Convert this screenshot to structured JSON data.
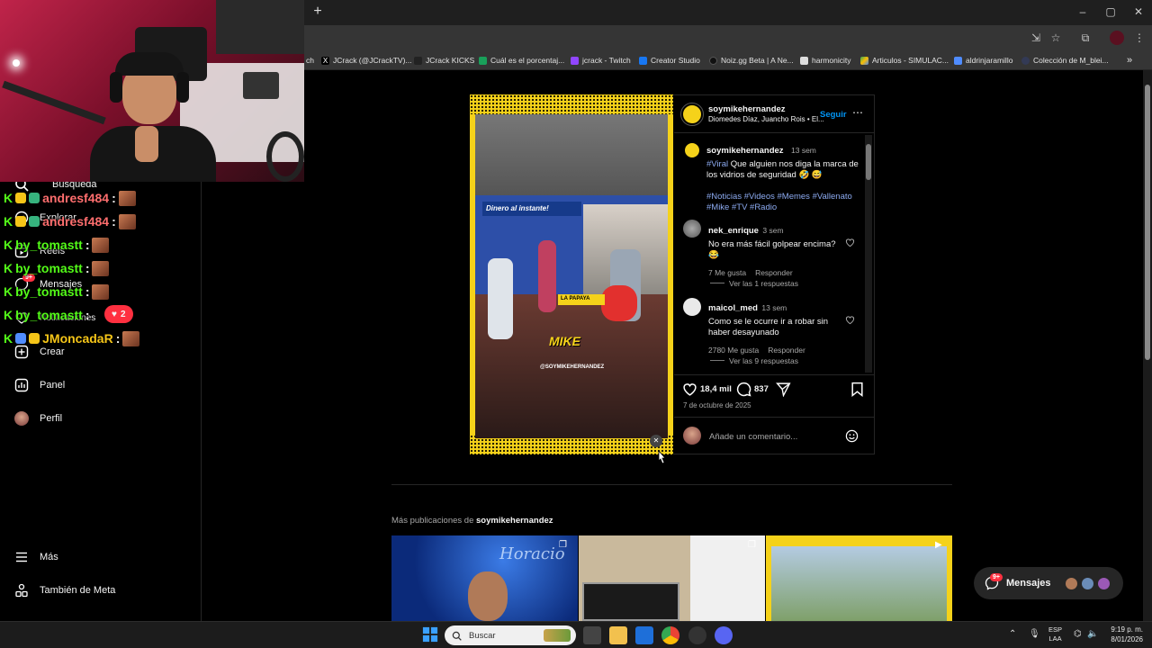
{
  "browser": {
    "new_tab": "+",
    "window_controls": {
      "minimize": "‒",
      "restore": "▢",
      "close": "✕"
    },
    "bookmarks": [
      {
        "label": "ch",
        "color": "#6441a5"
      },
      {
        "label": "JCrack (@JCrackTV)...",
        "color": "#000000"
      },
      {
        "label": "JCrack KICKS",
        "color": "#222222"
      },
      {
        "label": "Cuál es el porcentaj...",
        "color": "#19a05a"
      },
      {
        "label": "jcrack - Twitch",
        "color": "#9146ff"
      },
      {
        "label": "Creator Studio",
        "color": "#1877f2"
      },
      {
        "label": "Noiz.gg Beta | A Ne...",
        "color": "#111111"
      },
      {
        "label": "harmonicity",
        "color": "#dddddd"
      },
      {
        "label": "Articulos - SIMULAC...",
        "color": "#34a853"
      },
      {
        "label": "aldrinjaramillo",
        "color": "#4f8cff"
      },
      {
        "label": "Colección de M_blei...",
        "color": "#333a55"
      }
    ],
    "bookmarks_more": "»"
  },
  "nav": {
    "items": [
      {
        "label": "Búsqueda",
        "icon": "search-icon"
      },
      {
        "label": "Explorar",
        "icon": "compass-icon"
      },
      {
        "label": "Reels",
        "icon": "reels-icon"
      },
      {
        "label": "Mensajes",
        "icon": "messenger-icon",
        "badge": "9+"
      },
      {
        "label": "Notificaciones",
        "icon": "heart-icon"
      },
      {
        "label": "Crear",
        "icon": "plus-icon"
      },
      {
        "label": "Panel",
        "icon": "chart-icon"
      },
      {
        "label": "Perfil",
        "icon": "avatar-icon"
      }
    ],
    "more": "Más",
    "meta": "También de Meta",
    "notification_badge": "2"
  },
  "chat": [
    {
      "user": "andresf484",
      "sep": ":",
      "color": "#ff6e6e"
    },
    {
      "user": "andresf484",
      "sep": ":",
      "color": "#ff6e6e"
    },
    {
      "user": "by_tomastt",
      "sep": ":",
      "color": "#53fc18"
    },
    {
      "user": "by_tomastt",
      "sep": ":",
      "color": "#53fc18"
    },
    {
      "user": "by_tomastt",
      "sep": ":",
      "color": "#53fc18"
    },
    {
      "user": "by_tomastt",
      "sep": ":",
      "color": "#53fc18"
    },
    {
      "user": "JMoncadaR",
      "sep": ":",
      "color": "#f5c518"
    }
  ],
  "post": {
    "author": "soymikehernandez",
    "follow": "Seguir",
    "subtitle": "Diomedes Díaz, Juancho Rois • El...",
    "media_texts": {
      "sign": "Dinero al instante!",
      "stamp": "LA PAPAYA",
      "logo": "MIKE",
      "handle": "@SOYMIKEHERNANDEZ"
    },
    "caption": {
      "user": "soymikehernandez",
      "time": "13 sem",
      "tag_viral": "#Viral",
      "text": " Que alguien nos diga la marca de los vidrios de seguridad 🤣 😅",
      "tags_line1": "#Noticias #Videos #Memes #Vallenato",
      "tags_line2": "#Mike #TV #Radio"
    },
    "comments": [
      {
        "user": "nek_enrique",
        "time": "3 sem",
        "text": "No era más fácil golpear encima? 😂",
        "likes": "7 Me gusta",
        "reply": "Responder",
        "replies": "Ver las 1 respuestas"
      },
      {
        "user": "maicol_med",
        "time": "13 sem",
        "text": "Como se le ocurre ir a robar sin haber desayunado",
        "likes": "2780 Me gusta",
        "reply": "Responder",
        "replies": "Ver las 9 respuestas"
      }
    ],
    "like_count": "18,4 mil",
    "comment_count": "837",
    "date": "7 de octubre de 2025",
    "add_comment_placeholder": "Añade un comentario..."
  },
  "more_posts": {
    "prefix": "Más publicaciones de ",
    "user": "soymikehernandez",
    "thumb1_text": "Horacio"
  },
  "messages_pill": {
    "label": "Mensajes",
    "badge": "9+"
  },
  "taskbar": {
    "search": "Buscar",
    "lang1": "ESP",
    "lang2": "LAA",
    "time": "9:19 p. m.",
    "date": "8/01/2026"
  }
}
